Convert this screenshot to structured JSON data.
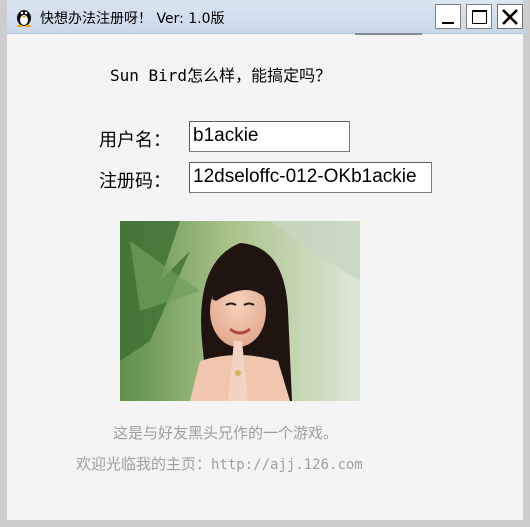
{
  "window": {
    "title": "快想办法注册呀！ Ver: 1.0版",
    "icon": "penguin-app-icon"
  },
  "dialog": {
    "question": "Sun Bird怎么样，能搞定吗？",
    "username_label": "用户名：",
    "username_value": "b1ackie",
    "regcode_label": "注册码：",
    "regcode_value": "12dseloffc-012-OKb1ackie",
    "footer_line1": "这是与好友黑头兄作的一个游戏。",
    "footer_line2_prefix": "欢迎光临我的主页：",
    "footer_line2_url": "http://ajj.126.com"
  },
  "colors": {
    "titlebar": "#d3e0ef",
    "footer_text": "#9e9e9e",
    "window_bg": "#f4f4f4"
  }
}
